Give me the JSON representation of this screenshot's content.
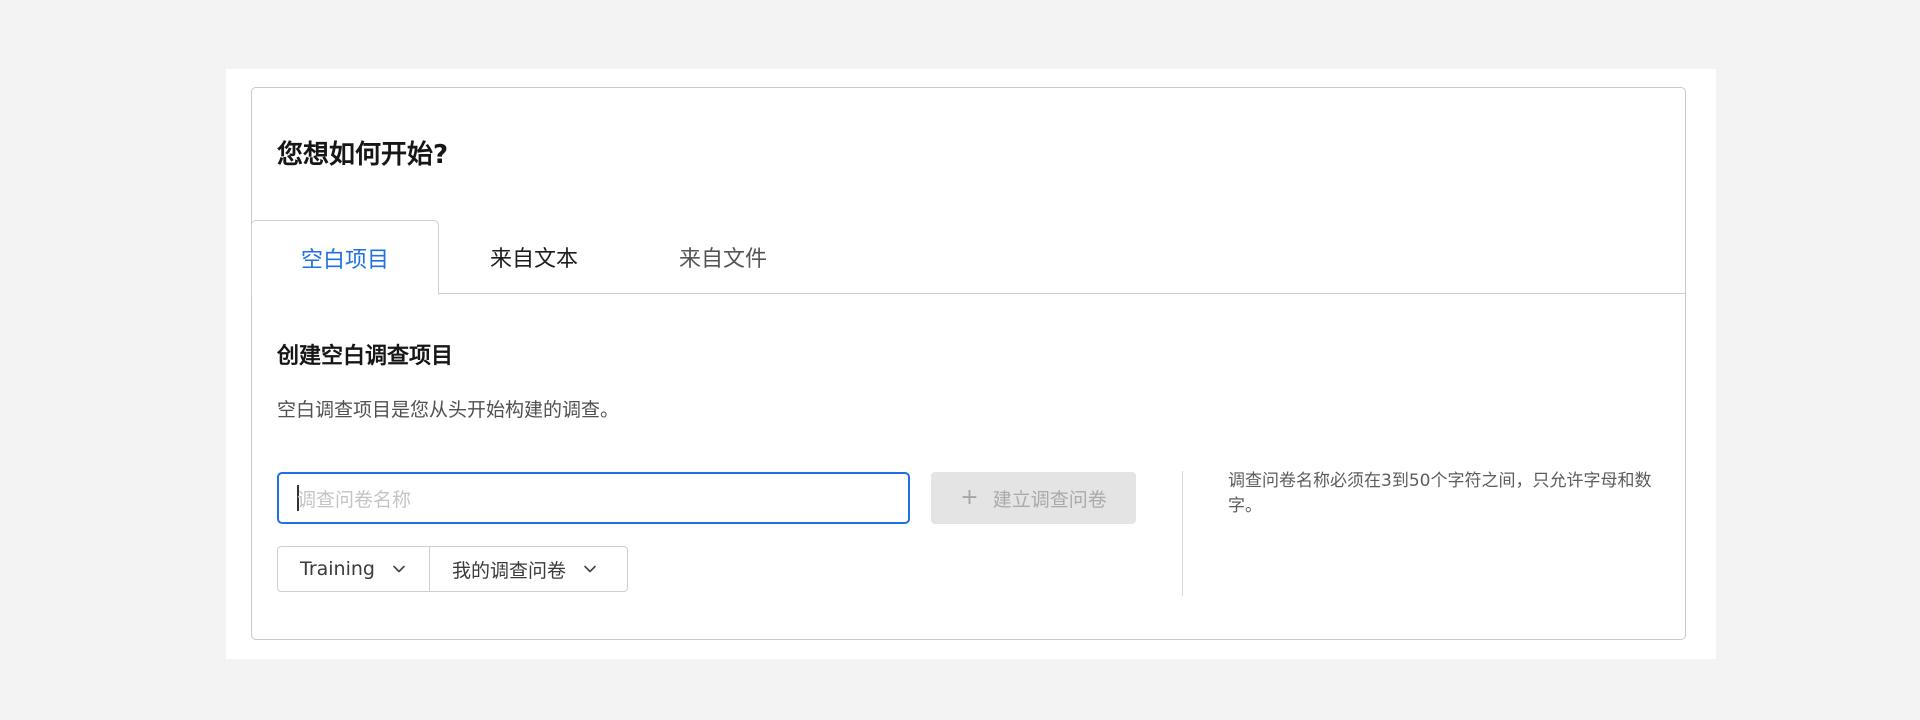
{
  "heading": "您想如何开始?",
  "tabs": [
    {
      "label": "空白项目",
      "active": true
    },
    {
      "label": "来自文本",
      "active": false
    },
    {
      "label": "来自文件",
      "active": false
    }
  ],
  "section": {
    "title": "创建空白调查项目",
    "description": "空白调查项目是您从头开始构建的调查。"
  },
  "name_input": {
    "value": "",
    "placeholder": "调查问卷名称"
  },
  "create_button": {
    "label": "建立调查问卷",
    "icon": "plus-icon",
    "disabled": true
  },
  "hint": "调查问卷名称必须在3到50个字符之间，只允许字母和数字。",
  "selects": [
    {
      "value": "Training",
      "icon": "chevron-down-icon"
    },
    {
      "value": "我的调查问卷",
      "icon": "chevron-down-icon"
    }
  ],
  "colors": {
    "accent": "#1f70e0",
    "page_bg": "#f3f3f3",
    "disabled_bg": "#e4e4e4"
  }
}
